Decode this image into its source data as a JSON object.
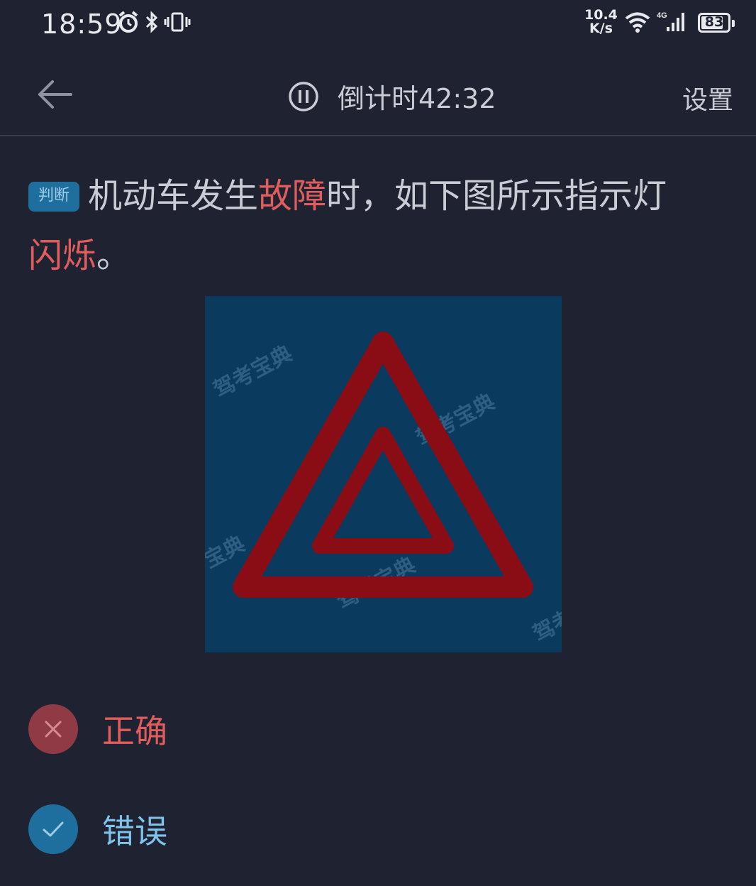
{
  "status_bar": {
    "time": "18:59",
    "net_speed_value": "10.4",
    "net_speed_unit": "K/s",
    "network": "4G",
    "battery": "83",
    "battery_level": 0.83,
    "icons": [
      "alarm-icon",
      "bluetooth-icon",
      "vibrate-icon",
      "wifi-icon",
      "signal-icon",
      "battery-icon"
    ]
  },
  "header": {
    "back_icon": "back-arrow-icon",
    "pause_icon": "pause-icon",
    "timer": "倒计时42:32",
    "settings": "设置"
  },
  "question": {
    "tag": "判断",
    "segments": [
      {
        "text": "机动车发生",
        "highlight": false
      },
      {
        "text": "故障",
        "highlight": true
      },
      {
        "text": "时，如下图所示指示灯",
        "highlight": false
      },
      {
        "text": "闪烁",
        "highlight": true
      },
      {
        "text": "。",
        "highlight": false
      }
    ],
    "image": {
      "description_icon": "hazard-warning-triangle-icon",
      "watermark": "驾考宝典",
      "watermark_partial_1": "宝典",
      "watermark_partial_2": "驾考"
    }
  },
  "options": [
    {
      "label": "正确",
      "state": "wrong",
      "icon": "close-icon"
    },
    {
      "label": "错误",
      "state": "correct",
      "icon": "check-icon"
    }
  ],
  "colors": {
    "background": "#1f2230",
    "highlight": "#e05d5d",
    "accent": "#1f6f9e",
    "image_bg": "#0a3a5e",
    "hazard_red": "#8a0c14"
  }
}
